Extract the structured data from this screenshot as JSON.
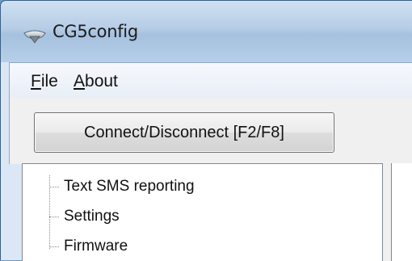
{
  "window": {
    "title": "CG5config",
    "icon": "app-icon"
  },
  "menu": {
    "items": [
      {
        "mnemonic": "F",
        "rest": "ile"
      },
      {
        "mnemonic": "A",
        "rest": "bout"
      }
    ]
  },
  "toolbar": {
    "connect_label": "Connect/Disconnect [F2/F8]"
  },
  "tree": {
    "items": [
      {
        "label": "Text SMS reporting"
      },
      {
        "label": "Settings"
      },
      {
        "label": "Firmware"
      }
    ]
  }
}
